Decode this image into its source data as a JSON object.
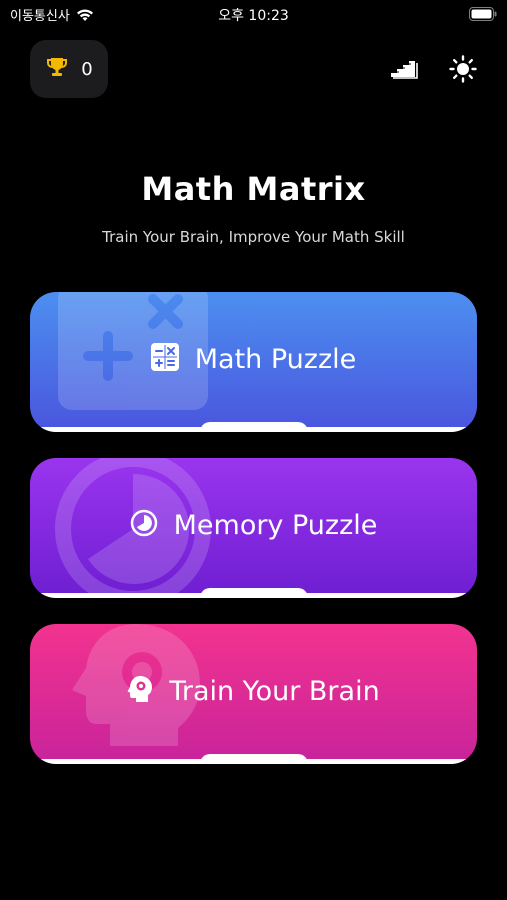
{
  "status_bar": {
    "carrier": "이동통신사",
    "time": "오후 10:23"
  },
  "header": {
    "trophy_count": "0"
  },
  "main": {
    "title": "Math Matrix",
    "subtitle": "Train Your Brain, Improve Your Math Skill",
    "cards": [
      {
        "label": "Math Puzzle",
        "icon": "calculator-icon",
        "color_top": "#4c8ff0",
        "color_bottom": "#4a55de"
      },
      {
        "label": "Memory Puzzle",
        "icon": "pie-timer-icon",
        "color_top": "#9a35ee",
        "color_bottom": "#6e1ed2"
      },
      {
        "label": "Train Your Brain",
        "icon": "brain-head-icon",
        "color_top": "#f2338f",
        "color_bottom": "#c8239b"
      }
    ]
  },
  "colors": {
    "background": "#000000",
    "trophy": "#f5b800"
  }
}
